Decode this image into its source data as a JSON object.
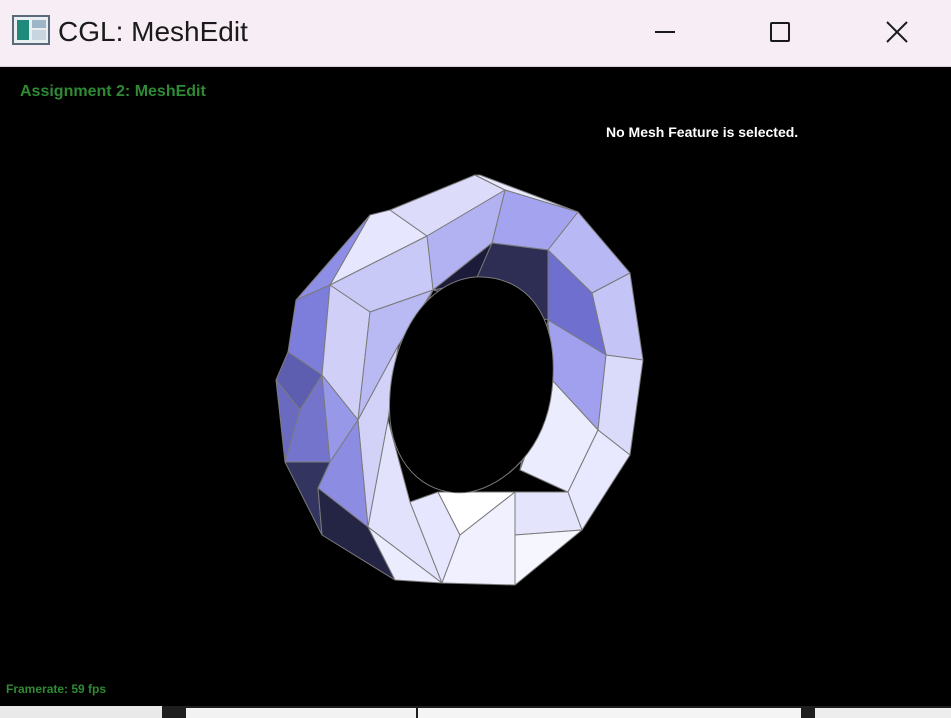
{
  "window": {
    "title": "CGL: MeshEdit",
    "icons": {
      "app": "app-window-icon",
      "minimize": "minimize-icon",
      "maximize": "maximize-icon",
      "close": "close-icon"
    }
  },
  "viewport": {
    "heading": "Assignment 2: MeshEdit",
    "status": "No Mesh Feature is selected.",
    "framerate": "Framerate: 59 fps",
    "colors": {
      "accent_green": "#2f8a34",
      "background": "#000000",
      "mesh_light": "#e8e8ff",
      "mesh_mid": "#9a9af0",
      "mesh_dark": "#2a2a48",
      "edge": "#7a7a7a"
    }
  }
}
